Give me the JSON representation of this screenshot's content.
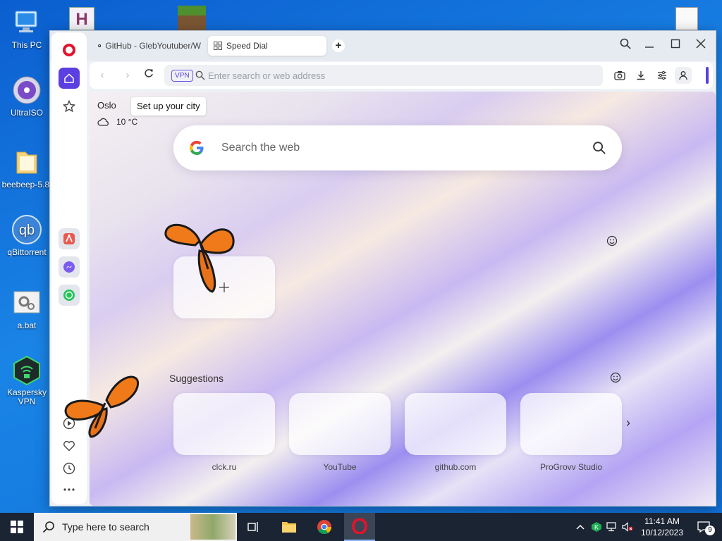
{
  "desktop": {
    "icons": [
      {
        "label": "This PC"
      },
      {
        "label": "UltraISO"
      },
      {
        "label": "beebeep-5.8."
      },
      {
        "label": "qBittorrent"
      },
      {
        "label": "a.bat"
      },
      {
        "label": "Kaspersky VPN"
      }
    ]
  },
  "browser": {
    "tabs": [
      {
        "label": "GitHub - GlebYoutuber/W",
        "active": false
      },
      {
        "label": "Speed Dial",
        "active": true
      }
    ],
    "address_placeholder": "Enter search or web address",
    "vpn_badge": "VPN",
    "accent_color": "#5b3fe0"
  },
  "speed_dial": {
    "weather": {
      "city": "Oslo",
      "temperature": "10 °C",
      "tooltip": "Set up your city"
    },
    "search_placeholder": "Search the web",
    "suggestions_title": "Suggestions",
    "suggestions": [
      {
        "label": "clck.ru"
      },
      {
        "label": "YouTube"
      },
      {
        "label": "github.com"
      },
      {
        "label": "ProGrovv Studio"
      }
    ]
  },
  "taskbar": {
    "search_placeholder": "Type here to search",
    "time": "11:41 AM",
    "date": "10/12/2023",
    "notification_count": "9"
  }
}
